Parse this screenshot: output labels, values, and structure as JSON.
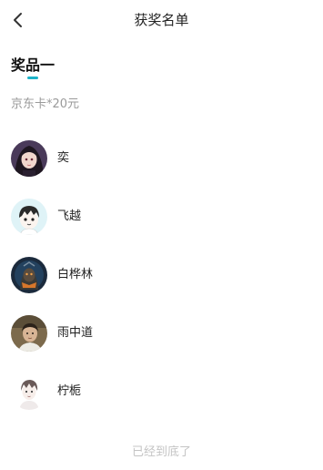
{
  "header": {
    "back_icon": "chevron-left-icon",
    "title": "获奖名单"
  },
  "section": {
    "title": "奖品一",
    "accent_color": "#1cb3c8",
    "prize": "京东卡*20元"
  },
  "winners": [
    {
      "name": "奕",
      "avatar": "avatar-dark-hair-girl"
    },
    {
      "name": "飞越",
      "avatar": "avatar-cartoon-boy"
    },
    {
      "name": "白桦林",
      "avatar": "avatar-armored-figure"
    },
    {
      "name": "雨中道",
      "avatar": "avatar-young-man-photo"
    },
    {
      "name": "柠栀",
      "avatar": "avatar-sketch-boy"
    }
  ],
  "footer": {
    "end_text": "已经到底了"
  }
}
